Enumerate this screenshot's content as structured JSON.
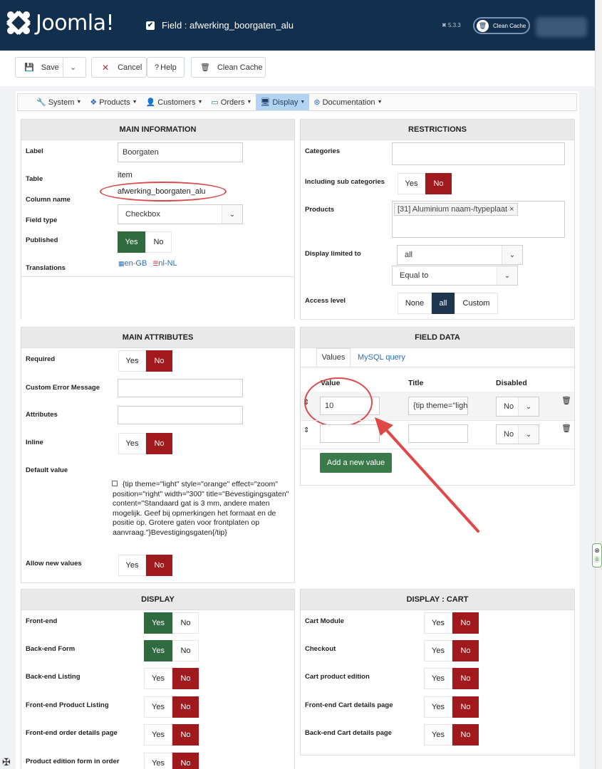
{
  "app": {
    "name": "Joomla!",
    "page_title": "Field : afwerking_boorgaten_alu",
    "version": "5.3.3",
    "clean_cache": "Clean Cache"
  },
  "toolbar": {
    "save": "Save",
    "cancel": "Cancel",
    "help": "Help",
    "clean_cache": "Clean Cache"
  },
  "menu": {
    "items": [
      "System",
      "Products",
      "Customers",
      "Orders",
      "Display",
      "Documentation"
    ],
    "active": "Display"
  },
  "main_info": {
    "header": "MAIN INFORMATION",
    "label_lbl": "Label",
    "label_val": "Boorgaten",
    "table_lbl": "Table",
    "table_val": "item",
    "column_lbl": "Column name",
    "column_val": "afwerking_boorgaten_alu",
    "fieldtype_lbl": "Field type",
    "fieldtype_val": "Checkbox",
    "published_lbl": "Published",
    "yes": "Yes",
    "no": "No",
    "translations_lbl": "Translations",
    "tr1": "en-GB",
    "tr2": "nl-NL"
  },
  "restrictions": {
    "header": "RESTRICTIONS",
    "categories_lbl": "Categories",
    "subcat_lbl": "Including sub categories",
    "products_lbl": "Products",
    "product_tag": "[31] Aluminium naam-/typeplaat",
    "display_lbl": "Display limited to",
    "display_val": "all",
    "equal_val": "Equal to",
    "access_lbl": "Access level",
    "access_none": "None",
    "access_all": "all",
    "access_custom": "Custom"
  },
  "attributes": {
    "header": "MAIN ATTRIBUTES",
    "required_lbl": "Required",
    "error_lbl": "Custom Error Message",
    "attributes_lbl": "Attributes",
    "inline_lbl": "Inline",
    "default_lbl": "Default value",
    "default_text": "{tip theme=\"light\" style=\"orange\" effect=\"zoom\" position=\"right\" width=\"300\" title=\"Bevestigingsgaten\" content=\"Standaard gat is 3 mm, andere maten mogelijk. Geef bij opmerkingen het formaat en de positie op. Grotere gaten voor frontplaten op aanvraag.\"}Bevestigingsgaten{/tip}",
    "allow_lbl": "Allow new values"
  },
  "field_data": {
    "header": "FIELD DATA",
    "tab_values": "Values",
    "tab_mysql": "MySQL query",
    "col_value": "Value",
    "col_title": "Title",
    "col_disabled": "Disabled",
    "row1_value": "10",
    "row1_title": "{tip theme=\"ligh",
    "row1_disabled": "No",
    "row2_disabled": "No",
    "add_btn": "Add a new value"
  },
  "display": {
    "header": "DISPLAY",
    "rows": [
      "Front-end",
      "Back-end Form",
      "Back-end Listing",
      "Front-end Product Listing",
      "Front-end order details page",
      "Product edition form in order"
    ]
  },
  "display_cart": {
    "header": "DISPLAY : CART",
    "rows": [
      "Cart Module",
      "Checkout",
      "Cart product edition",
      "Front-end Cart details page",
      "Back-end Cart details page"
    ]
  },
  "colors": {
    "navy": "#132f4e",
    "green": "#2f6b3f",
    "red": "#a0191d",
    "annotation": "#d94a4a"
  }
}
